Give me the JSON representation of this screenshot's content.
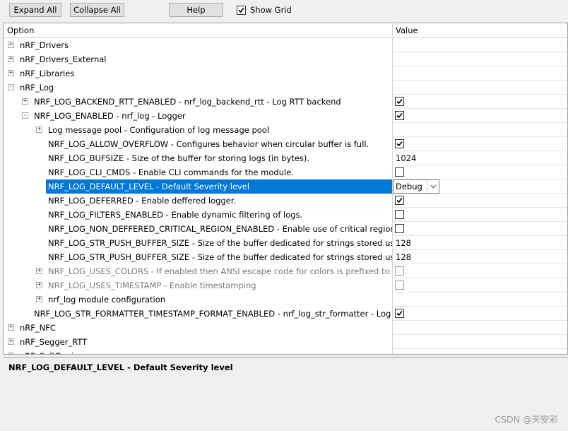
{
  "toolbar": {
    "expand_all": "Expand All",
    "collapse_all": "Collapse All",
    "help": "Help",
    "show_grid": "Show Grid",
    "show_grid_checked": true
  },
  "grid": {
    "col_option": "Option",
    "col_value": "Value",
    "rows": [
      {
        "indent": 0,
        "expander": "+",
        "label": "nRF_Drivers",
        "value_type": "none"
      },
      {
        "indent": 0,
        "expander": "+",
        "label": "nRF_Drivers_External",
        "value_type": "none"
      },
      {
        "indent": 0,
        "expander": "+",
        "label": "nRF_Libraries",
        "value_type": "none"
      },
      {
        "indent": 0,
        "expander": "-",
        "label": "nRF_Log",
        "value_type": "none"
      },
      {
        "indent": 1,
        "expander": "+",
        "label": "NRF_LOG_BACKEND_RTT_ENABLED - nrf_log_backend_rtt - Log RTT backend",
        "value_type": "check",
        "checked": true
      },
      {
        "indent": 1,
        "expander": "-",
        "label": "NRF_LOG_ENABLED - nrf_log - Logger",
        "value_type": "check",
        "checked": true
      },
      {
        "indent": 2,
        "expander": "+",
        "label": "Log message pool - Configuration of log message pool",
        "value_type": "none"
      },
      {
        "indent": 2,
        "expander": "",
        "label": "NRF_LOG_ALLOW_OVERFLOW  - Configures behavior when circular buffer is full.",
        "value_type": "check",
        "checked": true
      },
      {
        "indent": 2,
        "expander": "",
        "label": "NRF_LOG_BUFSIZE  - Size of the buffer for storing logs (in bytes).",
        "value_type": "text",
        "value": "1024"
      },
      {
        "indent": 2,
        "expander": "",
        "label": "NRF_LOG_CLI_CMDS  - Enable CLI commands for the module.",
        "value_type": "check",
        "checked": false
      },
      {
        "indent": 2,
        "expander": "",
        "label": "NRF_LOG_DEFAULT_LEVEL  - Default Severity level",
        "value_type": "dropdown",
        "value": "Debug",
        "selected": true
      },
      {
        "indent": 2,
        "expander": "",
        "label": "NRF_LOG_DEFERRED  - Enable deffered logger.",
        "value_type": "check",
        "checked": true
      },
      {
        "indent": 2,
        "expander": "",
        "label": "NRF_LOG_FILTERS_ENABLED  - Enable dynamic filtering of logs.",
        "value_type": "check",
        "checked": false
      },
      {
        "indent": 2,
        "expander": "",
        "label": "NRF_LOG_NON_DEFFERED_CRITICAL_REGION_ENABLED  - Enable use of critical region for...",
        "value_type": "check",
        "checked": false
      },
      {
        "indent": 2,
        "expander": "",
        "label": "NRF_LOG_STR_PUSH_BUFFER_SIZE  - Size of the buffer dedicated for strings stored using ...",
        "value_type": "text",
        "value": "128"
      },
      {
        "indent": 2,
        "expander": "",
        "label": "NRF_LOG_STR_PUSH_BUFFER_SIZE  - Size of the buffer dedicated for strings stored using ...",
        "value_type": "text",
        "value": "128"
      },
      {
        "indent": 2,
        "expander": "+",
        "label": "NRF_LOG_USES_COLORS - If enabled then ANSI escape code for colors is prefixed to every...",
        "value_type": "check",
        "checked": false,
        "disabled": true
      },
      {
        "indent": 2,
        "expander": "+",
        "label": "NRF_LOG_USES_TIMESTAMP - Enable timestamping",
        "value_type": "check",
        "checked": false,
        "disabled": true
      },
      {
        "indent": 2,
        "expander": "+",
        "label": "nrf_log module configuration",
        "value_type": "none"
      },
      {
        "indent": 1,
        "expander": "",
        "label": "NRF_LOG_STR_FORMATTER_TIMESTAMP_FORMAT_ENABLED  - nrf_log_str_formatter - Log stri...",
        "value_type": "check",
        "checked": true
      },
      {
        "indent": 0,
        "expander": "+",
        "label": "nRF_NFC",
        "value_type": "none"
      },
      {
        "indent": 0,
        "expander": "+",
        "label": "nRF_Segger_RTT",
        "value_type": "none"
      },
      {
        "indent": 0,
        "expander": "+",
        "label": "nRF_SoftDevice",
        "value_type": "none"
      }
    ]
  },
  "description": {
    "title": "NRF_LOG_DEFAULT_LEVEL  - Default Severity level"
  },
  "watermark": "CSDN @天安彩"
}
